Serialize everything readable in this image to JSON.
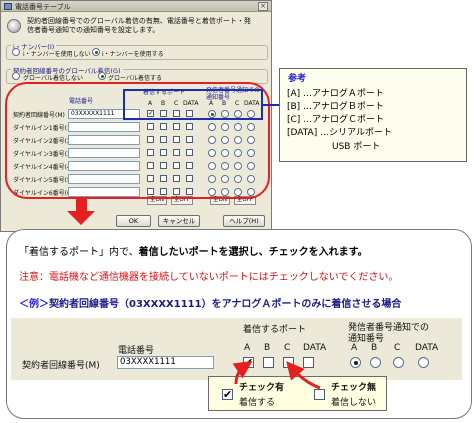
{
  "dialog": {
    "title": "電話番号テーブル",
    "close_glyph": "×",
    "info_text": "契約者回線番号でのグローバル着信の有無、電話番号と着信ポート・発信者番号通知での通知番号を設定します。",
    "inumber_group": {
      "label": "i・ナンバー(I)",
      "options": [
        "i・ナンバーを使用しない",
        "i・ナンバーを使用する"
      ],
      "selected": 0
    },
    "global_group": {
      "label": "契約者回線番号のグローバル着信(G)",
      "options": [
        "グローバル着信しない",
        "グローバル着信する"
      ],
      "selected": 1
    },
    "table": {
      "col_tel": "電話番号",
      "col_incoming": "着信するポート",
      "col_notify": "発信者番号通知での通知番号",
      "port_headers": [
        "A",
        "B",
        "C",
        "DATA"
      ],
      "notify_headers": [
        "A",
        "B",
        "C",
        "DATA"
      ],
      "rows": [
        {
          "label": "契約者回線番号(M)",
          "tel": "03XXXXX1111",
          "incoming": [
            true,
            false,
            false,
            false
          ],
          "notify": [
            true,
            false,
            false,
            false
          ]
        },
        {
          "label": "ダイヤルイン1番号(1)",
          "tel": "",
          "incoming": [
            false,
            false,
            false,
            false
          ],
          "notify": [
            false,
            false,
            false,
            false
          ]
        },
        {
          "label": "ダイヤルイン2番号(2)",
          "tel": "",
          "incoming": [
            false,
            false,
            false,
            false
          ],
          "notify": [
            false,
            false,
            false,
            false
          ]
        },
        {
          "label": "ダイヤルイン3番号(3)",
          "tel": "",
          "incoming": [
            false,
            false,
            false,
            false
          ],
          "notify": [
            false,
            false,
            false,
            false
          ]
        },
        {
          "label": "ダイヤルイン4番号(4)",
          "tel": "",
          "incoming": [
            false,
            false,
            false,
            false
          ],
          "notify": [
            false,
            false,
            false,
            false
          ]
        },
        {
          "label": "ダイヤルイン5番号(5)",
          "tel": "",
          "incoming": [
            false,
            false,
            false,
            false
          ],
          "notify": [
            false,
            false,
            false,
            false
          ]
        },
        {
          "label": "ダイヤルイン6番号(6)",
          "tel": "",
          "incoming": [
            false,
            false,
            false,
            false
          ],
          "notify": [
            false,
            false,
            false,
            false
          ]
        }
      ]
    },
    "small_buttons": [
      "全ON",
      "全OFF",
      "全ON",
      "全OFF"
    ],
    "ok_label": "OK",
    "cancel_label": "キャンセル",
    "help_label": "ヘルプ(H)"
  },
  "reference": {
    "title": "参考",
    "lines": [
      "[A] …アナログＡポート",
      "[B] …アナログＢポート",
      "[C] …アナログＣポート",
      "[DATA] …シリアルポート",
      "USB ポート"
    ]
  },
  "panel": {
    "line1_parts": [
      "「着信するポート」内で、",
      "着信したいポートを選択し、チェックを入れます。"
    ],
    "line2": "注意：電話機など通信機器を接続していないポートにはチェックしないでください。",
    "line3_example": "＜例＞",
    "line3_rest": "契約者回線番号（03XXXX1111）をアナログＡポートのみに着信させる場合"
  },
  "zoom": {
    "incoming_header": "着信するポート",
    "notify_header_1": "発信者番号通知での",
    "notify_header_2": "通知番号",
    "tel_header": "電話番号",
    "row_label": "契約者回線番号(M)",
    "tel_value": "03XXXX1111",
    "port_headers": [
      "A",
      "B",
      "C",
      "DATA"
    ],
    "notify_headers": [
      "A",
      "B",
      "C",
      "DATA"
    ],
    "incoming": [
      true,
      false,
      false,
      false
    ],
    "notify_selected": 0
  },
  "legend": {
    "checked_title": "チェック有",
    "checked_desc": "着信する",
    "unchecked_title": "チェック無",
    "unchecked_desc": "着信しない",
    "check_glyph": "✔"
  },
  "colors": {
    "annotation_red": "#e62020",
    "annotation_blue": "#1a2fb0",
    "dialog_bg": "#ece9d8"
  }
}
